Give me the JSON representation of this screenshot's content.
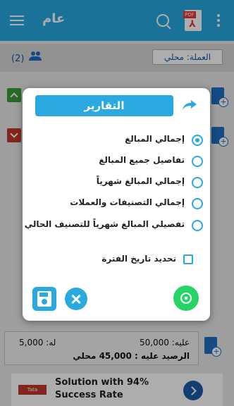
{
  "appbar": {
    "title": "عام"
  },
  "pdf": {
    "tag": "PDF"
  },
  "list": {
    "count": "(2)",
    "currency": "العملة: محلي"
  },
  "summary": {
    "alayh": "عليه: 50,000",
    "lah": "له: 5,000",
    "balance": "الرصيد عليه : 45,000 محلي"
  },
  "dialog": {
    "title": "التقارير",
    "options": [
      {
        "label": "إجمالي المبالغ",
        "selected": true
      },
      {
        "label": "تفاصيل جميع المبالغ",
        "selected": false
      },
      {
        "label": "إجمالي المبالغ شهرياً",
        "selected": false
      },
      {
        "label": "إجمالي التصنيفات والعملات",
        "selected": false
      },
      {
        "label": "تفصيلي المبالغ شهرياً للتصنيف الحالي",
        "selected": false
      }
    ],
    "period_label": "تحديد تاريخ الفترة"
  },
  "ad": {
    "text": "Solution with 94% Success Rate",
    "brand": "Tata"
  },
  "colors": {
    "primary": "#29a9e0",
    "appbar": "#27a8e0",
    "whatsapp": "#25d366"
  },
  "icons": [
    "menu-icon",
    "search-icon",
    "pdf-icon",
    "more-vert-icon",
    "people-icon",
    "share-icon",
    "save-icon",
    "close-icon",
    "whatsapp-icon"
  ]
}
